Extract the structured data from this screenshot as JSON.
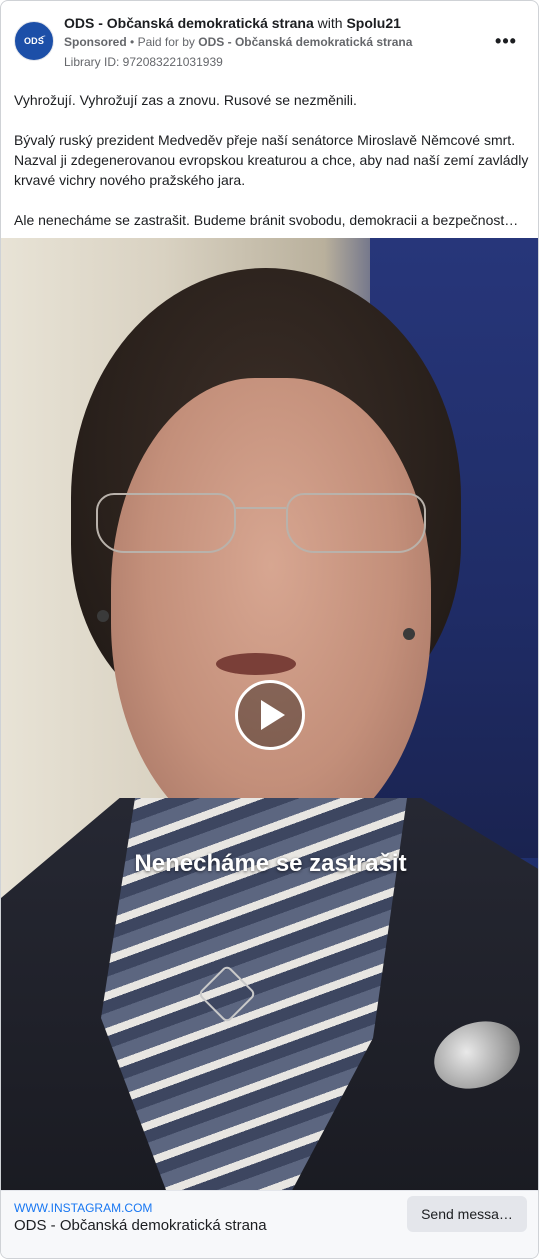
{
  "header": {
    "page_name": "ODS - Občanská demokratická strana",
    "with_text": "with",
    "partner_name": "Spolu21",
    "sponsored": "Sponsored",
    "separator": "•",
    "paid_for_label": "Paid for by",
    "paid_for_name": "ODS - Občanská demokratická strana",
    "library_id": "Library ID: 972083221031939",
    "avatar_text": "ODS",
    "more_icon": "more-horizontal-icon"
  },
  "post": {
    "line1": "Vyhrožují. Vyhrožují zas a znovu. Rusové se nezměnili.",
    "line2": "Bývalý ruský prezident Medveděv přeje naší senátorce Miroslavě Němcové smrt.",
    "line3": "Nazval ji zdegenerovanou evropskou kreaturou a chce, aby nad naší zemí zavládly",
    "line4": "krvavé vichry nového pražského jara.",
    "line5": "Ale nenecháme se zastrašit. Budeme bránit svobodu, demokracii a bezpečnost…"
  },
  "media": {
    "caption": "Nenecháme se zastrašit",
    "play_icon": "play-icon"
  },
  "footer": {
    "domain": "WWW.INSTAGRAM.COM",
    "title": "ODS - Občanská demokratická strana",
    "cta_label": "Send messa…"
  },
  "colors": {
    "link": "#1877f2",
    "avatar_bg": "#1c4fa8",
    "muted": "#65676b"
  }
}
